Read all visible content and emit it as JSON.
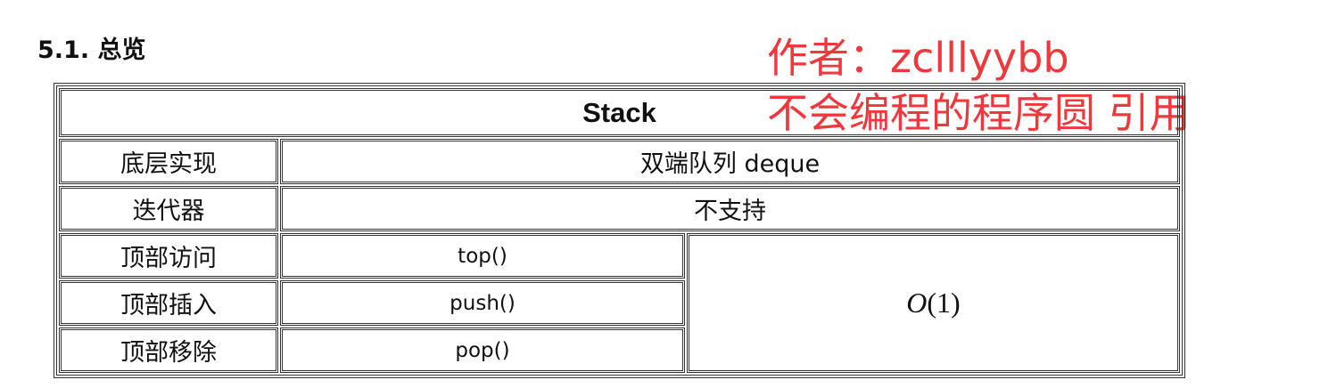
{
  "heading": "5.1.  总览",
  "watermark": {
    "line1": "作者：zclllyybb",
    "line2": "不会编程的程序圆 引用"
  },
  "table": {
    "title": "Stack",
    "rows": [
      {
        "label": "底层实现",
        "value": "双端队列 deque"
      },
      {
        "label": "迭代器",
        "value": "不支持"
      },
      {
        "label": "顶部访问",
        "value": "top()"
      },
      {
        "label": "顶部插入",
        "value": "push()"
      },
      {
        "label": "顶部移除",
        "value": "pop()"
      }
    ],
    "complexity": {
      "letter": "O",
      "arg": "(1)"
    }
  }
}
